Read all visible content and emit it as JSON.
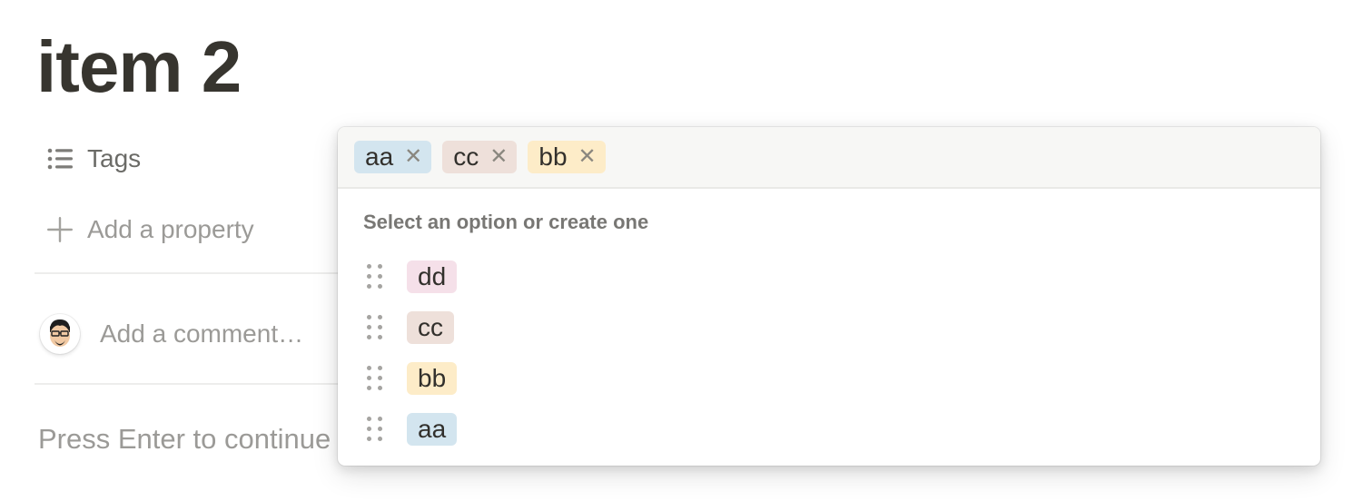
{
  "page": {
    "title": "item 2"
  },
  "properties": {
    "tags_label": "Tags",
    "add_property_label": "Add a property"
  },
  "comment": {
    "placeholder": "Add a comment…",
    "avatar_icon": "avatar-icon"
  },
  "footer": {
    "press_enter_text": "Press Enter to continue"
  },
  "popup": {
    "selected": [
      {
        "label": "aa",
        "bg": "#d3e5ef",
        "x_symbol": "✕"
      },
      {
        "label": "cc",
        "bg": "#eee0da",
        "x_symbol": "✕"
      },
      {
        "label": "bb",
        "bg": "#fdecc8",
        "x_symbol": "✕"
      }
    ],
    "hint": "Select an option or create one",
    "options": [
      {
        "label": "dd",
        "bg": "#f5e0e9"
      },
      {
        "label": "cc",
        "bg": "#eee0da"
      },
      {
        "label": "bb",
        "bg": "#fdecc8"
      },
      {
        "label": "aa",
        "bg": "#d3e5ef"
      }
    ]
  },
  "colors": {
    "title": "#37352f",
    "muted": "#9b9a97"
  }
}
